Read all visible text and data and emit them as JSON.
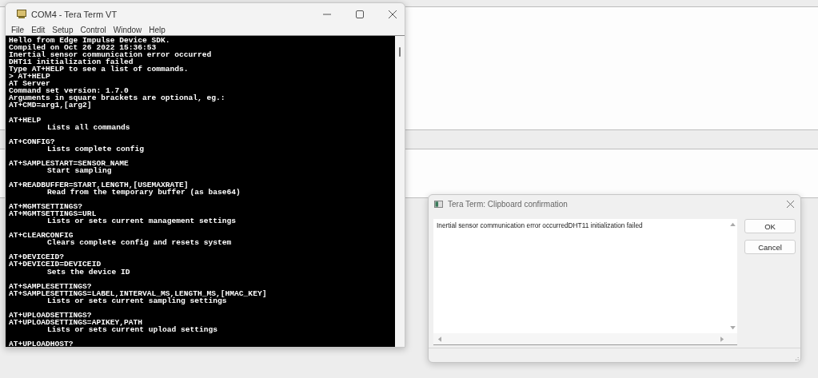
{
  "terminal": {
    "title": "COM4 - Tera Term VT",
    "menu": [
      "File",
      "Edit",
      "Setup",
      "Control",
      "Window",
      "Help"
    ],
    "blocks": [
      {
        "lines": [
          {
            "text": "Hello from Edge Impulse Device SDK.",
            "indented": false
          },
          {
            "text": "Compiled on Oct 26 2022 15:36:53",
            "indented": false
          },
          {
            "text": "Inertial sensor communication error occurred",
            "indented": false
          },
          {
            "text": "DHT11 initialization failed",
            "indented": false
          },
          {
            "text": "Type AT+HELP to see a list of commands.",
            "indented": false
          },
          {
            "text": "> AT+HELP",
            "indented": false
          },
          {
            "text": "AT Server",
            "indented": false
          },
          {
            "text": "Command set version: 1.7.0",
            "indented": false
          },
          {
            "text": "Arguments in square brackets are optional, eg.:",
            "indented": false
          },
          {
            "text": "AT+CMD=arg1,[arg2]",
            "indented": false
          }
        ]
      },
      {
        "lines": [
          {
            "text": "AT+HELP",
            "indented": false
          },
          {
            "text": "Lists all commands",
            "indented": true
          }
        ]
      },
      {
        "lines": [
          {
            "text": "AT+CONFIG?",
            "indented": false
          },
          {
            "text": "Lists complete config",
            "indented": true
          }
        ]
      },
      {
        "lines": [
          {
            "text": "AT+SAMPLESTART=SENSOR_NAME",
            "indented": false
          },
          {
            "text": "Start sampling",
            "indented": true
          }
        ]
      },
      {
        "lines": [
          {
            "text": "AT+READBUFFER=START,LENGTH,[USEMAXRATE]",
            "indented": false
          },
          {
            "text": "Read from the temporary buffer (as base64)",
            "indented": true
          }
        ]
      },
      {
        "lines": [
          {
            "text": "AT+MGMTSETTINGS?",
            "indented": false
          },
          {
            "text": "AT+MGMTSETTINGS=URL",
            "indented": false
          },
          {
            "text": "Lists or sets current management settings",
            "indented": true
          }
        ]
      },
      {
        "lines": [
          {
            "text": "AT+CLEARCONFIG",
            "indented": false
          },
          {
            "text": "Clears complete config and resets system",
            "indented": true
          }
        ]
      },
      {
        "lines": [
          {
            "text": "AT+DEVICEID?",
            "indented": false
          },
          {
            "text": "AT+DEVICEID=DEVICEID",
            "indented": false
          },
          {
            "text": "Sets the device ID",
            "indented": true
          }
        ]
      },
      {
        "lines": [
          {
            "text": "AT+SAMPLESETTINGS?",
            "indented": false
          },
          {
            "text": "AT+SAMPLESETTINGS=LABEL,INTERVAL_MS,LENGTH_MS,[HMAC_KEY]",
            "indented": false
          },
          {
            "text": "Lists or sets current sampling settings",
            "indented": true
          }
        ]
      },
      {
        "lines": [
          {
            "text": "AT+UPLOADSETTINGS?",
            "indented": false
          },
          {
            "text": "AT+UPLOADSETTINGS=APIKEY,PATH",
            "indented": false
          },
          {
            "text": "Lists or sets current upload settings",
            "indented": true
          }
        ]
      },
      {
        "lines": [
          {
            "text": "AT+UPLOADHOST?",
            "indented": false
          }
        ]
      }
    ]
  },
  "dialog": {
    "title": "Tera Term: Clipboard confirmation",
    "content": "Inertial sensor communication error occurredDHT11 initialization failed",
    "buttons": [
      "OK",
      "Cancel"
    ]
  }
}
